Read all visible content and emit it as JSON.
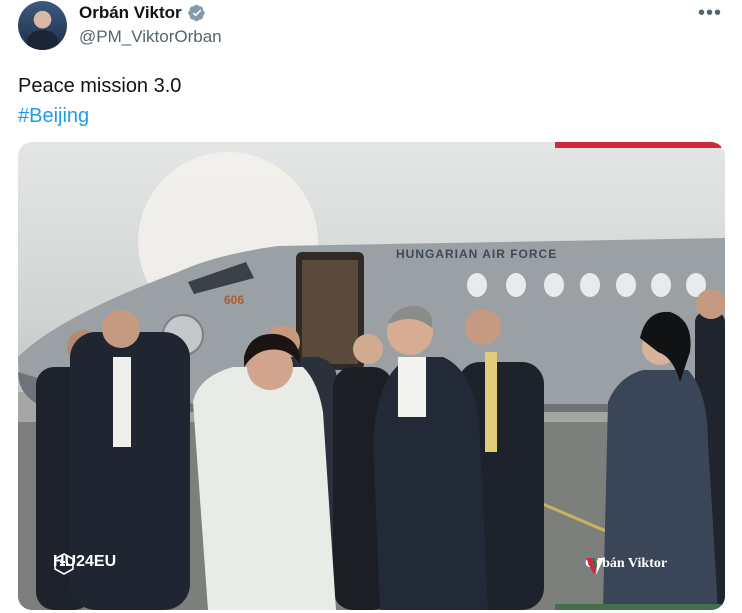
{
  "author": {
    "display_name": "Orbán Viktor",
    "handle": "@PM_ViktorOrban",
    "verified_icon": "verified-badge-icon",
    "more_label": "•••"
  },
  "tweet": {
    "text": "Peace mission 3.0",
    "hashtag": "#Beijing"
  },
  "media": {
    "plane_lettering": "HUNGARIAN AIR FORCE",
    "plane_number": "606",
    "watermark_left": "HU24EU",
    "watermark_right": "Orbán Viktor"
  },
  "colors": {
    "hashtag": "#1d9bf0",
    "verified": "#829aab",
    "brand_red": "#cd2a3e",
    "brand_green": "#436f4d"
  }
}
